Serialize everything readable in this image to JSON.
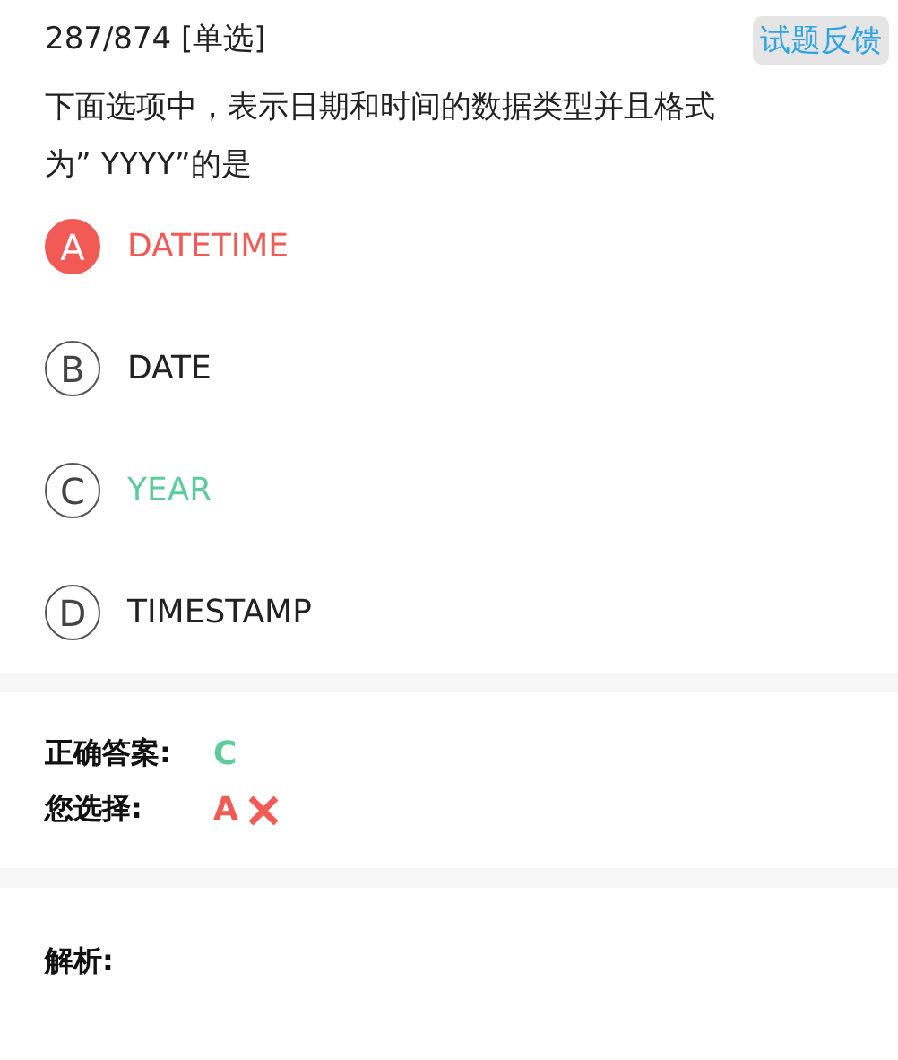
{
  "header": {
    "counter": "287/874 [单选]",
    "feedback_button": "试题反馈"
  },
  "question": "下面选项中，表示日期和时间的数据类型并且格式为” YYYY”的是",
  "options": [
    {
      "letter": "A",
      "text": "DATETIME",
      "selected": true,
      "correct": false
    },
    {
      "letter": "B",
      "text": "DATE",
      "selected": false,
      "correct": false
    },
    {
      "letter": "C",
      "text": "YEAR",
      "selected": false,
      "correct": true
    },
    {
      "letter": "D",
      "text": "TIMESTAMP",
      "selected": false,
      "correct": false
    }
  ],
  "answer": {
    "correct_label": "正确答案:",
    "correct_value": "C",
    "chosen_label": "您选择:",
    "chosen_value": "A",
    "chosen_is_correct": false
  },
  "explanation": {
    "label": "解析:"
  }
}
